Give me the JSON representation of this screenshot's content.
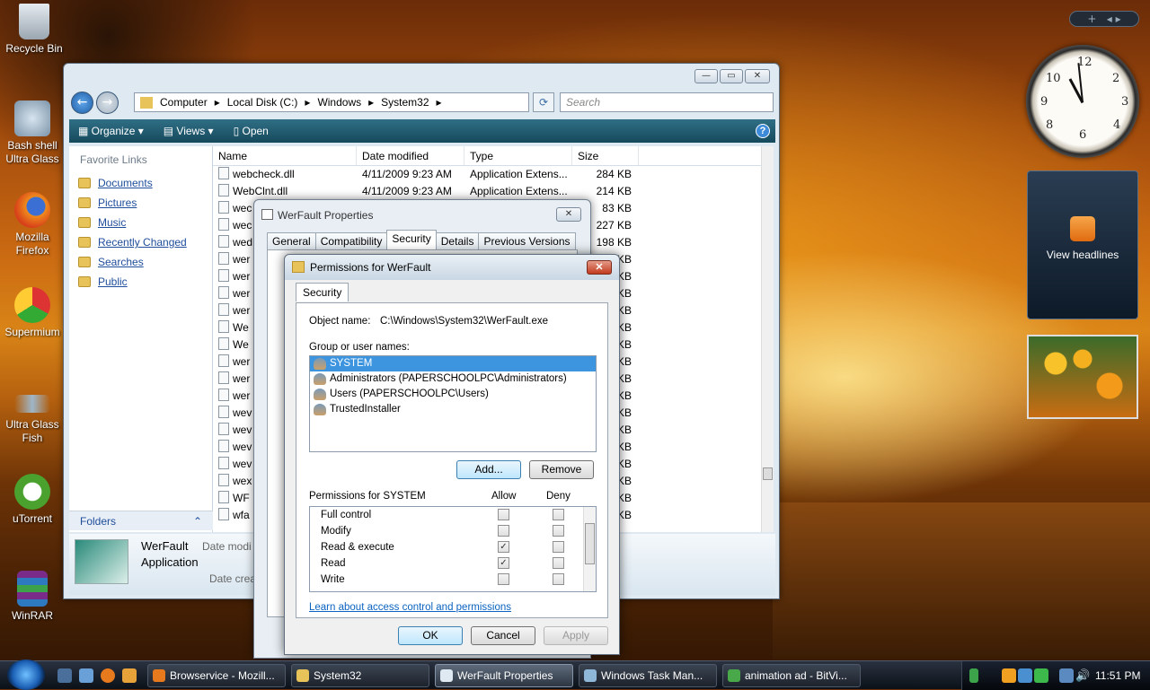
{
  "desktop": {
    "icons": [
      {
        "label": "Recycle Bin"
      },
      {
        "label": "Bash shell Ultra Glass"
      },
      {
        "label": "Mozilla Firefox"
      },
      {
        "label": "Supermium"
      },
      {
        "label": "Ultra Glass Fish"
      },
      {
        "label": "uTorrent"
      },
      {
        "label": "WinRAR"
      }
    ]
  },
  "explorer": {
    "breadcrumbs": [
      "Computer",
      "Local Disk (C:)",
      "Windows",
      "System32"
    ],
    "search_placeholder": "Search",
    "toolbar": {
      "organize": "Organize",
      "views": "Views",
      "open": "Open"
    },
    "sidebar": {
      "heading": "Favorite Links",
      "links": [
        "Documents",
        "Pictures",
        "Music",
        "Recently Changed",
        "Searches",
        "Public"
      ],
      "folders": "Folders"
    },
    "columns": [
      "Name",
      "Date modified",
      "Type",
      "Size"
    ],
    "files": [
      {
        "name": "webcheck.dll",
        "date": "4/11/2009 9:23 AM",
        "type": "Application Extens...",
        "size": "284 KB"
      },
      {
        "name": "WebClnt.dll",
        "date": "4/11/2009 9:23 AM",
        "type": "Application Extens...",
        "size": "214 KB"
      },
      {
        "name": "wec",
        "date": "",
        "type": "",
        "size": "83 KB"
      },
      {
        "name": "wec",
        "date": "",
        "type": "",
        "size": "227 KB"
      },
      {
        "name": "wed",
        "date": "",
        "type": "",
        "size": "198 KB"
      },
      {
        "name": "wer",
        "date": "",
        "type": "",
        "size": "KB"
      },
      {
        "name": "wer",
        "date": "",
        "type": "",
        "size": "KB"
      },
      {
        "name": "wer",
        "date": "",
        "type": "",
        "size": "KB"
      },
      {
        "name": "wer",
        "date": "",
        "type": "",
        "size": "KB"
      },
      {
        "name": "We",
        "date": "",
        "type": "",
        "size": "KB"
      },
      {
        "name": "We",
        "date": "",
        "type": "",
        "size": "KB"
      },
      {
        "name": "wer",
        "date": "",
        "type": "",
        "size": "KB"
      },
      {
        "name": "wer",
        "date": "",
        "type": "",
        "size": "KB"
      },
      {
        "name": "wer",
        "date": "",
        "type": "",
        "size": "KB"
      },
      {
        "name": "wev",
        "date": "",
        "type": "",
        "size": "KB"
      },
      {
        "name": "wev",
        "date": "",
        "type": "",
        "size": "KB"
      },
      {
        "name": "wev",
        "date": "",
        "type": "",
        "size": "KB"
      },
      {
        "name": "wev",
        "date": "",
        "type": "",
        "size": "KB"
      },
      {
        "name": "wex",
        "date": "",
        "type": "",
        "size": "KB"
      },
      {
        "name": "WF",
        "date": "",
        "type": "",
        "size": "KB"
      },
      {
        "name": "wfa",
        "date": "",
        "type": "",
        "size": "KB"
      }
    ],
    "details": {
      "name": "WerFault",
      "type": "Application",
      "date_modified": "Date modi",
      "date_created": "Date crea"
    }
  },
  "props": {
    "title": "WerFault Properties",
    "tabs": [
      "General",
      "Compatibility",
      "Security",
      "Details",
      "Previous Versions"
    ],
    "active_tab": "Security"
  },
  "perm": {
    "title": "Permissions for WerFault",
    "tab": "Security",
    "object_label": "Object name:",
    "object_value": "C:\\Windows\\System32\\WerFault.exe",
    "group_label": "Group or user names:",
    "users": [
      "SYSTEM",
      "Administrators (PAPERSCHOOLPC\\Administrators)",
      "Users (PAPERSCHOOLPC\\Users)",
      "TrustedInstaller"
    ],
    "selected_user": "SYSTEM",
    "add_button": "Add...",
    "remove_button": "Remove",
    "permissions_label": "Permissions for SYSTEM",
    "allow_header": "Allow",
    "deny_header": "Deny",
    "permissions": [
      {
        "name": "Full control",
        "allow": false,
        "deny": false
      },
      {
        "name": "Modify",
        "allow": false,
        "deny": false
      },
      {
        "name": "Read & execute",
        "allow": true,
        "deny": false
      },
      {
        "name": "Read",
        "allow": true,
        "deny": false
      },
      {
        "name": "Write",
        "allow": false,
        "deny": false
      }
    ],
    "help_link": "Learn about access control and permissions",
    "ok": "OK",
    "cancel": "Cancel",
    "apply": "Apply"
  },
  "gadgets": {
    "news": "View headlines",
    "clock_time": "11:51"
  },
  "taskbar": {
    "buttons": [
      {
        "label": "Browservice - Mozill...",
        "color": "#e87a1e"
      },
      {
        "label": "System32",
        "color": "#e8c35a"
      },
      {
        "label": "WerFault Properties",
        "color": "#dfe9f2"
      },
      {
        "label": "Windows Task Man...",
        "color": "#8fb8d8"
      },
      {
        "label": "animation ad - BitVi...",
        "color": "#49a84a"
      }
    ],
    "time": "11:51 PM"
  }
}
